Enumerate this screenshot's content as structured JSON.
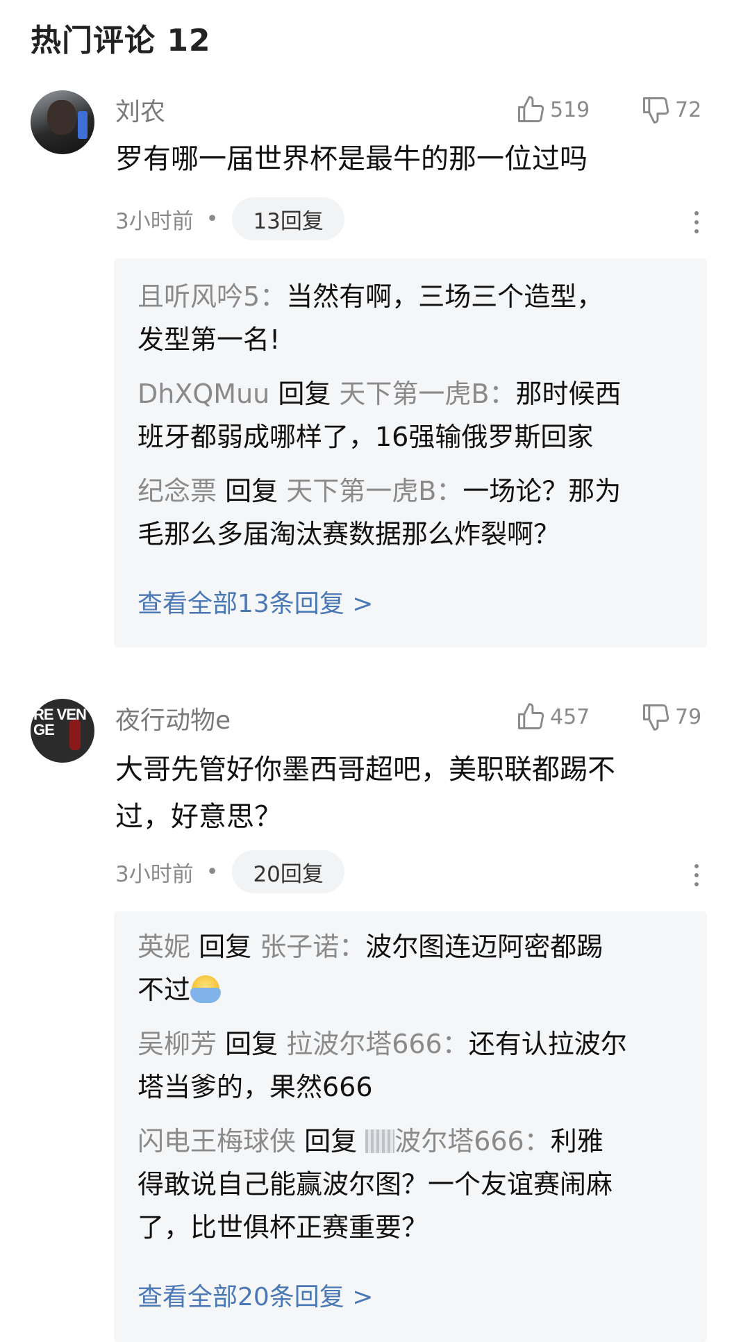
{
  "header": {
    "title": "热门评论 12"
  },
  "comments": [
    {
      "username": "刘农",
      "likes": "519",
      "dislikes": "72",
      "text": "罗有哪一届世界杯是最牛的那一位过吗",
      "time": "3小时前",
      "reply_count_label": "13回复",
      "replies": [
        {
          "name": "且听风吟5",
          "sep": "：",
          "text_line1": "当然有啊，三场三个造型，",
          "text_line2": "发型第一名!"
        },
        {
          "name": "DhXQMuu",
          "reply_word": " 回复 ",
          "target": "天下第一虎B",
          "sep": "：",
          "text_line1": "那时候西",
          "text_line2": "班牙都弱成哪样了，16强输俄罗斯回家"
        },
        {
          "name": "纪念票",
          "reply_word": " 回复 ",
          "target": "天下第一虎B",
          "sep": "：",
          "text_line1": "一场论？那为",
          "text_line2": "毛那么多届淘汰赛数据那么炸裂啊？"
        }
      ],
      "view_all": "查看全部13条回复 >"
    },
    {
      "username": "夜行动物e",
      "likes": "457",
      "dislikes": "79",
      "text_line1": "大哥先管好你墨西哥超吧，美职联都踢不",
      "text_line2": "过，好意思？",
      "time": "3小时前",
      "reply_count_label": "20回复",
      "avatar_text": "RE VEN GE",
      "replies": [
        {
          "name": "英妮",
          "reply_word": " 回复 ",
          "target": "张子诺",
          "sep": "：",
          "text_line1": "波尔图连迈阿密都踢",
          "text_line2": "不过"
        },
        {
          "name": "吴柳芳",
          "reply_word": " 回复 ",
          "target": "拉波尔塔666",
          "sep": "：",
          "text_line1": "还有认拉波尔",
          "text_line2": "塔当爹的，果然666"
        },
        {
          "name": "闪电王梅球侠",
          "reply_word": " 回复 ",
          "target": "波尔塔666",
          "sep": "：",
          "text_line1": "利雅",
          "text_line2": "得敢说自己能赢波尔图？一个友谊赛闹麻",
          "text_line3": "了，比世俱杯正赛重要？"
        }
      ],
      "view_all": "查看全部20条回复 >"
    }
  ],
  "icons": {
    "like": "thumbs-up-icon",
    "dislike": "thumbs-down-icon",
    "more": "more-vertical-icon"
  }
}
